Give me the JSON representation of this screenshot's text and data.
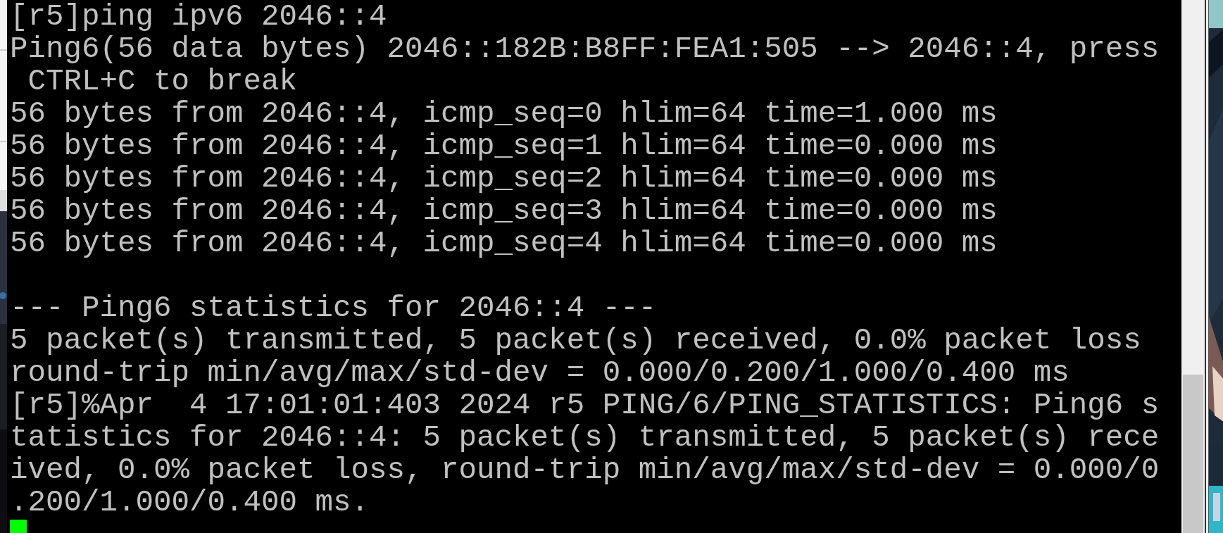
{
  "terminal": {
    "blocks": [
      {
        "lines": [
          "[r5]ping ipv6 2046::4",
          "Ping6(56 data bytes) 2046::182B:B8FF:FEA1:505 --> 2046::4, press",
          " CTRL+C to break",
          "56 bytes from 2046::4, icmp_seq=0 hlim=64 time=1.000 ms",
          "56 bytes from 2046::4, icmp_seq=1 hlim=64 time=0.000 ms",
          "56 bytes from 2046::4, icmp_seq=2 hlim=64 time=0.000 ms",
          "56 bytes from 2046::4, icmp_seq=3 hlim=64 time=0.000 ms",
          "56 bytes from 2046::4, icmp_seq=4 hlim=64 time=0.000 ms"
        ]
      },
      {
        "lines": [
          "--- Ping6 statistics for 2046::4 ---",
          "5 packet(s) transmitted, 5 packet(s) received, 0.0% packet loss",
          "round-trip min/avg/max/std-dev = 0.000/0.200/1.000/0.400 ms",
          "[r5]%Apr  4 17:01:01:403 2024 r5 PING/6/PING_STATISTICS: Ping6 s",
          "tatistics for 2046::4: 5 packet(s) transmitted, 5 packet(s) rece",
          "ived, 0.0% packet loss, round-trip min/avg/max/std-dev = 0.000/0",
          ".200/1.000/0.400 ms."
        ]
      }
    ],
    "cursor_visible": true
  }
}
